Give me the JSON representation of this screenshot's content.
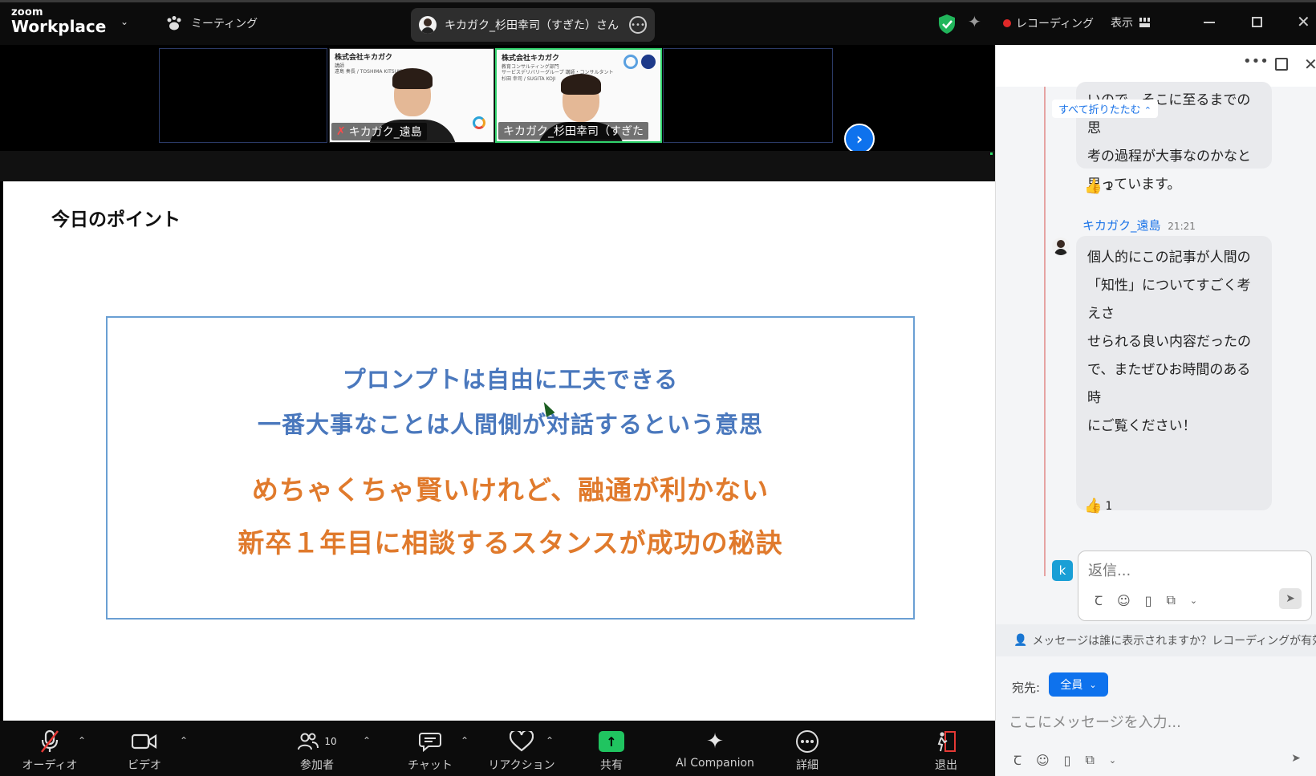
{
  "titlebar": {
    "logo_small": "zoom",
    "logo_big": "Workplace",
    "meeting_label": "ミーティング",
    "active_speaker": "キカガク_杉田幸司（すぎた）さん",
    "recording_label": "レコーディング",
    "view_label": "表示"
  },
  "videos": {
    "participant1": {
      "name": "キカガク_遠島",
      "company": "株式会社キカガク",
      "role": "講師",
      "romaji": "遠島 奏長 / TOSHIMA KITSUKI"
    },
    "participant2": {
      "name": "キカガク_杉田幸司（すぎた",
      "company": "株式会社キカガク",
      "role": "教育コンサルティング部門",
      "sub": "サービスデリバリーグループ 講師・コンサルタント",
      "romaji": "杉田 幸司 / SUGITA KOJI"
    }
  },
  "slide": {
    "title": "今日のポイント",
    "line1": "プロンプトは自由に工夫できる",
    "line2": "一番大事なことは人間側が対話するという意思",
    "line3": "めちゃくちゃ賢いけれど、融通が利かない",
    "line4": "新卒１年目に相談するスタンスが成功の秘訣"
  },
  "toolbar": {
    "audio": "オーディオ",
    "video": "ビデオ",
    "participants": "参加者",
    "participants_count": "10",
    "chat": "チャット",
    "reactions": "リアクション",
    "share": "共有",
    "ai": "AI Companion",
    "more": "詳細",
    "leave": "退出"
  },
  "chat": {
    "collapse_all": "すべて折りたたむ",
    "bubble1_lines": [
      "いので、そこに至るまでの思",
      "考の過程が大事なのかなと",
      "思っています。"
    ],
    "reaction1_count": "1",
    "sender": "キカガク_遠島",
    "sender_time": "21:21",
    "bubble2_lines": [
      "個人的にこの記事が人間の",
      "「知性」についてすごく考えさ",
      "せられる良い内容だったの",
      "で、またぜひお時間のある時",
      "にご覧ください！"
    ],
    "reaction2_count": "1",
    "me_initial": "k",
    "reply_placeholder": "返信...",
    "notice": "メッセージは誰に表示されますか？レコーディングが有効",
    "to_label": "宛先:",
    "to_value": "全員",
    "message_placeholder": "ここにメッセージを入力..."
  },
  "colors": {
    "accent": "#0e72ed",
    "share_green": "#20c460",
    "slide_blue": "#4a78bd",
    "slide_orange": "#e07a2c",
    "recording_red": "#e02828"
  }
}
